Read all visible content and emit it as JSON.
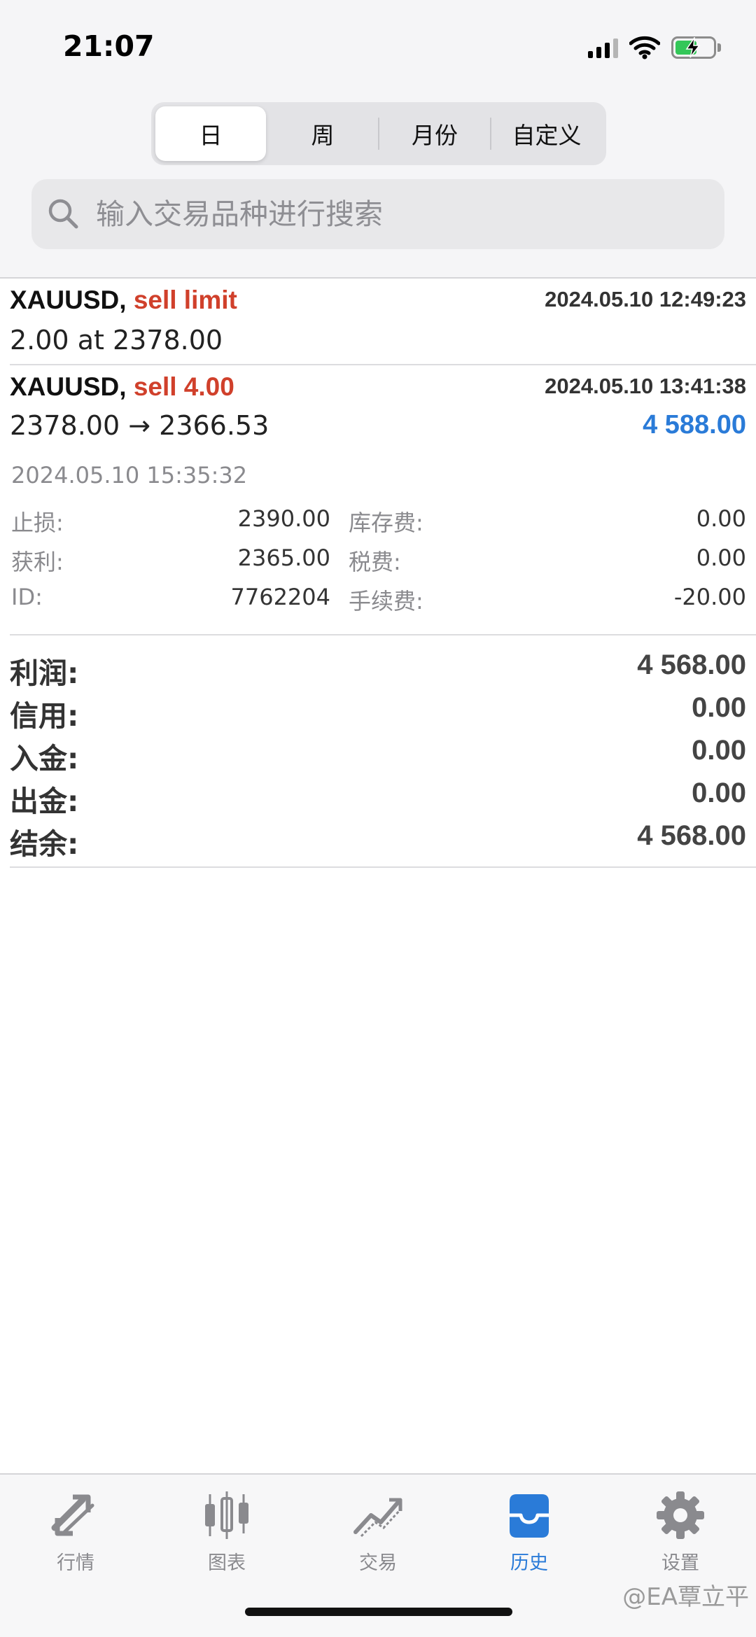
{
  "status_bar": {
    "time": "21:07"
  },
  "segments": {
    "day": "日",
    "week": "周",
    "month": "月份",
    "custom": "自定义"
  },
  "search": {
    "placeholder": "输入交易品种进行搜索"
  },
  "orders": [
    {
      "symbol": "XAUUSD,",
      "type": "sell limit",
      "time": "2024.05.10 12:49:23",
      "detail": "2.00 at 2378.00"
    },
    {
      "symbol": "XAUUSD,",
      "type": "sell 4.00",
      "time": "2024.05.10 13:41:38",
      "detail": "2378.00 → 2366.53",
      "profit": "4 588.00",
      "close_time": "2024.05.10 15:35:32",
      "fields": {
        "sl_label": "止损:",
        "sl": "2390.00",
        "tp_label": "获利:",
        "tp": "2365.00",
        "id_label": "ID:",
        "id": "7762204",
        "swap_label": "库存费:",
        "swap": "0.00",
        "tax_label": "税费:",
        "tax": "0.00",
        "fee_label": "手续费:",
        "fee": "-20.00"
      }
    }
  ],
  "summary": {
    "profit_label": "利润:",
    "profit": "4 568.00",
    "credit_label": "信用:",
    "credit": "0.00",
    "deposit_label": "入金:",
    "deposit": "0.00",
    "withdraw_label": "出金:",
    "withdraw": "0.00",
    "balance_label": "结余:",
    "balance": "4 568.00"
  },
  "tabs": [
    {
      "label": "行情",
      "icon": "quotes-arrows-icon"
    },
    {
      "label": "图表",
      "icon": "candlestick-chart-icon"
    },
    {
      "label": "交易",
      "icon": "trade-chart-icon"
    },
    {
      "label": "历史",
      "icon": "history-inbox-icon",
      "active": true
    },
    {
      "label": "设置",
      "icon": "gear-icon"
    }
  ],
  "watermark": "@EA覃立平",
  "colors": {
    "accent": "#2a7bd8",
    "sell_red": "#d0402b",
    "battery_green": "#34c759"
  }
}
